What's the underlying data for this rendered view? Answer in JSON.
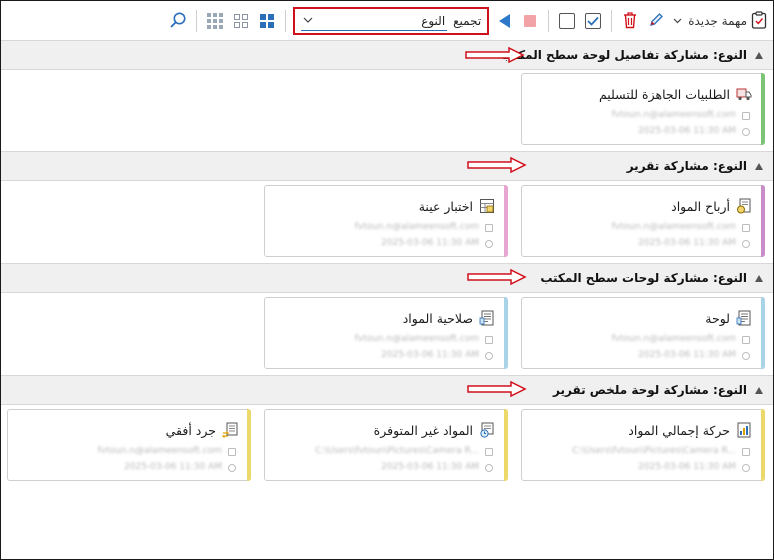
{
  "toolbar": {
    "new_task_label": "مهمة جديدة",
    "group_label": "تجميع",
    "group_value": "النوع",
    "icons": [
      "clipboard-icon",
      "chevron-down-icon",
      "pencil-icon",
      "trash-icon",
      "checkbox-checked-icon",
      "checkbox-empty-icon",
      "stop-icon",
      "play-icon",
      "large-tiles-icon",
      "medium-tiles-icon",
      "small-tiles-icon",
      "search-icon"
    ]
  },
  "groups": [
    {
      "title": "النوع: مشاركة تفاصيل لوحة سطح المكتب",
      "cards": [
        {
          "title": "الطلبيات الجاهزة للتسليم",
          "line1": "fvtoun.n@alameensoft.com",
          "line2": "2025-03-06 11:30 AM",
          "accent": "#7cc576",
          "icon": "truck-icon"
        }
      ]
    },
    {
      "title": "النوع: مشاركة تقرير",
      "cards": [
        {
          "title": "أرباح المواد",
          "line1": "fvtoun.n@alameensoft.com",
          "line2": "2025-03-06 11:30 AM",
          "accent": "#c98dc9",
          "icon": "report-coins-icon"
        },
        {
          "title": "اختبار عينة",
          "line1": "fvtoun.n@alameensoft.com",
          "line2": "2025-03-06 11:30 AM",
          "accent": "#e6a6cf",
          "icon": "report-grid-icon"
        }
      ]
    },
    {
      "title": "النوع: مشاركة لوحات سطح المكتب",
      "cards": [
        {
          "title": "لوحة",
          "line1": "fvtoun.n@alameensoft.com",
          "line2": "2025-03-06 11:30 AM",
          "accent": "#a9d3e6",
          "icon": "dashboard-doc-icon"
        },
        {
          "title": "صلاحية المواد",
          "line1": "fvtoun.n@alameensoft.com",
          "line2": "2025-03-06 11:30 AM",
          "accent": "#a9d3e6",
          "icon": "dashboard-doc-icon"
        }
      ]
    },
    {
      "title": "النوع: مشاركة لوحة ملخص تقرير",
      "cards": [
        {
          "title": "حركة إجمالي المواد",
          "line1": "C:\\Users\\fvtoun\\Pictures\\Camera R...",
          "line2": "2025-03-06 11:30 AM",
          "accent": "#ecd96a",
          "icon": "summary-chart-icon"
        },
        {
          "title": "المواد غير المتوفرة",
          "line1": "C:\\Users\\fvtoun\\Pictures\\Camera R...",
          "line2": "2025-03-06 11:30 AM",
          "accent": "#ecd96a",
          "icon": "summary-clock-icon"
        },
        {
          "title": "جرد أفقي",
          "line1": "fvtoun.n@alameensoft.com",
          "line2": "2025-03-06 11:30 AM",
          "accent": "#ecd96a",
          "icon": "summary-exchange-icon"
        }
      ]
    }
  ]
}
